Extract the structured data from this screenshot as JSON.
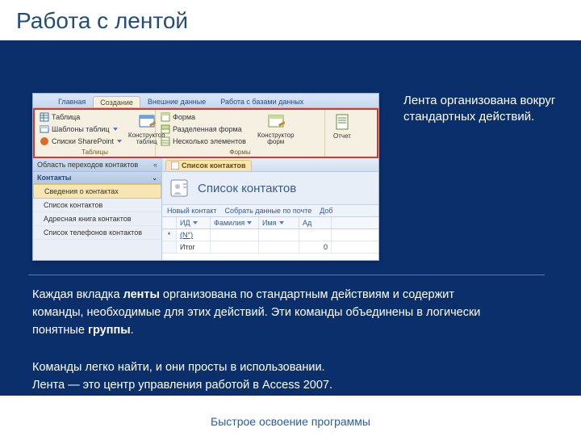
{
  "title": "Работа с лентой",
  "callout": "Лента организована вокруг стандартных действий.",
  "body1_pre": "Каждая вкладка ",
  "body1_b1": "ленты",
  "body1_mid": " организована по стандартным действиям и содержит команды, необходимые для этих действий. Эти команды объединены в логически понятные ",
  "body1_b2": "группы",
  "body1_post": ".",
  "body2_l1": "Команды легко найти, и они просты в использовании.",
  "body2_l2": "Лента — это центр управления работой в Access 2007.",
  "footer": "Быстрое освоение программы",
  "ribbon": {
    "tabs": [
      "Главная",
      "Создание",
      "Внешние данные",
      "Работа с базами данных"
    ],
    "active": 1,
    "groups": {
      "tables": {
        "title": "Таблицы",
        "c1": "Таблица",
        "c2": "Шаблоны таблиц",
        "c3": "Списки SharePoint",
        "c4l1": "Конструктор",
        "c4l2": "таблиц"
      },
      "forms": {
        "title": "Формы",
        "c1": "Форма",
        "c2": "Разделенная форма",
        "c3": "Несколько элементов",
        "c4l1": "Конструктор",
        "c4l2": "форм"
      },
      "reports": {
        "c1": "Отчет"
      }
    }
  },
  "nav": {
    "header": "Область переходов контактов",
    "category": "Контакты",
    "items": [
      "Сведения о контактах",
      "Список контактов",
      "Адресная книга контактов",
      "Список телефонов контактов"
    ]
  },
  "doc": {
    "tab": "Список контактов",
    "formtitle": "Список контактов",
    "toolbar": {
      "a": "Новый контакт",
      "b": "Собрать данные по почте",
      "c": "Доб"
    },
    "cols": {
      "id": "ИД",
      "last": "Фамилия",
      "first": "Имя",
      "addr": "Ад"
    },
    "newlink": "(N°)",
    "totalrow": "Итог",
    "totalval": "0"
  }
}
